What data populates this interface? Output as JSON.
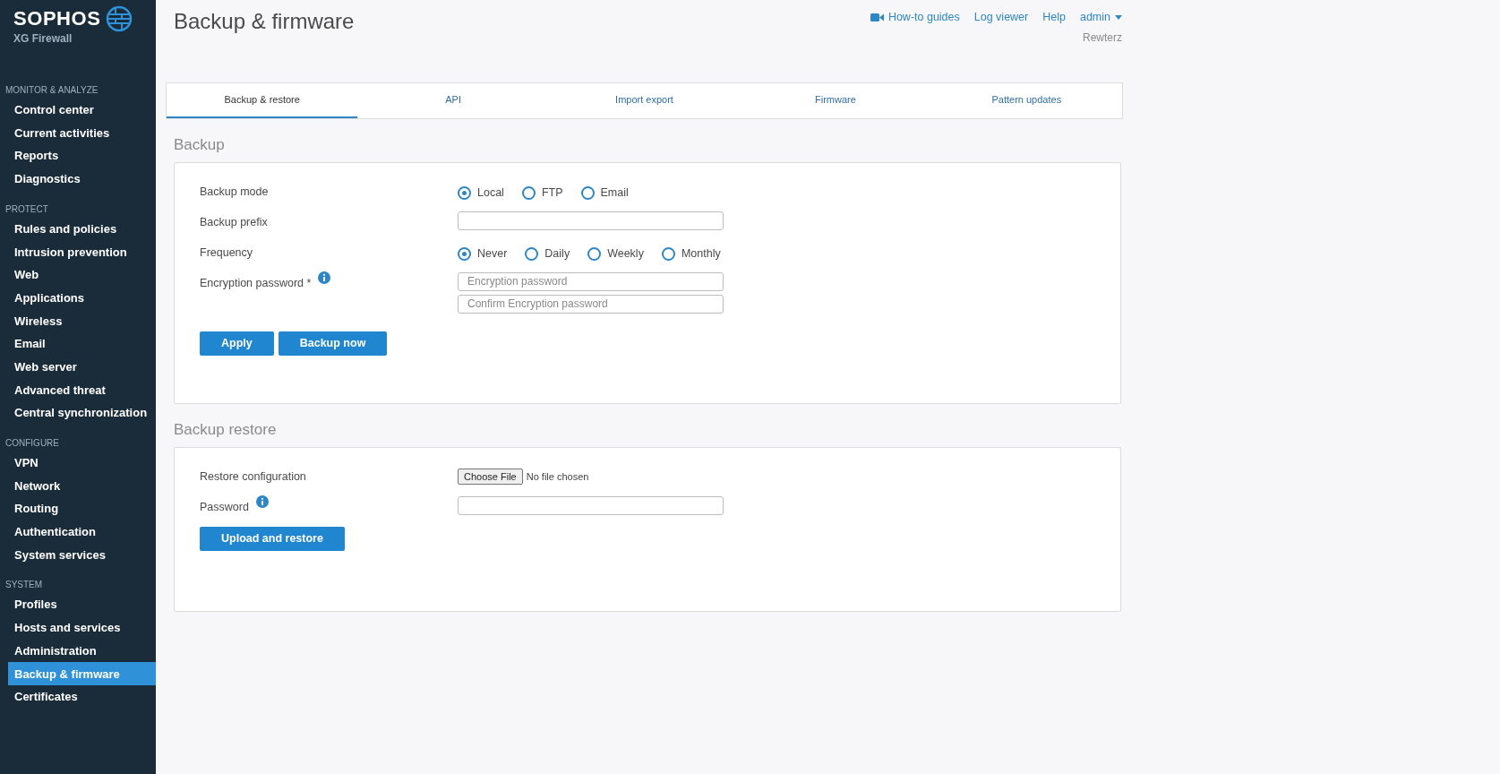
{
  "logo": {
    "brand": "SOPHOS",
    "product": "XG Firewall"
  },
  "sidebar": {
    "sections": [
      {
        "heading": "MONITOR & ANALYZE",
        "items": [
          {
            "label": "Control center",
            "selected": false
          },
          {
            "label": "Current activities",
            "selected": false
          },
          {
            "label": "Reports",
            "selected": false
          },
          {
            "label": "Diagnostics",
            "selected": false
          }
        ]
      },
      {
        "heading": "PROTECT",
        "items": [
          {
            "label": "Rules and policies",
            "selected": false
          },
          {
            "label": "Intrusion prevention",
            "selected": false
          },
          {
            "label": "Web",
            "selected": false
          },
          {
            "label": "Applications",
            "selected": false
          },
          {
            "label": "Wireless",
            "selected": false
          },
          {
            "label": "Email",
            "selected": false
          },
          {
            "label": "Web server",
            "selected": false
          },
          {
            "label": "Advanced threat",
            "selected": false
          },
          {
            "label": "Central synchronization",
            "selected": false
          }
        ]
      },
      {
        "heading": "CONFIGURE",
        "items": [
          {
            "label": "VPN",
            "selected": false
          },
          {
            "label": "Network",
            "selected": false
          },
          {
            "label": "Routing",
            "selected": false
          },
          {
            "label": "Authentication",
            "selected": false
          },
          {
            "label": "System services",
            "selected": false
          }
        ]
      },
      {
        "heading": "SYSTEM",
        "items": [
          {
            "label": "Profiles",
            "selected": false
          },
          {
            "label": "Hosts and services",
            "selected": false
          },
          {
            "label": "Administration",
            "selected": false
          },
          {
            "label": "Backup & firmware",
            "selected": true
          },
          {
            "label": "Certificates",
            "selected": false
          }
        ]
      }
    ]
  },
  "page_title": "Backup & firmware",
  "header_links": [
    {
      "label": "How-to guides",
      "kind": "video"
    },
    {
      "label": "Log viewer",
      "kind": "plain"
    },
    {
      "label": "Help",
      "kind": "plain"
    },
    {
      "label": "admin",
      "kind": "dropdown"
    }
  ],
  "device_name": "Rewterz",
  "tabs": [
    {
      "label": "Backup & restore",
      "selected": true
    },
    {
      "label": "API",
      "selected": false
    },
    {
      "label": "Import export",
      "selected": false
    },
    {
      "label": "Firmware",
      "selected": false
    },
    {
      "label": "Pattern updates",
      "selected": false
    }
  ],
  "backup": {
    "heading": "Backup",
    "rows": [
      {
        "kind": "radio",
        "label": "Backup mode",
        "options": [
          {
            "label": "Local",
            "selected": true
          },
          {
            "label": "FTP",
            "selected": false
          },
          {
            "label": "Email",
            "selected": false
          }
        ]
      },
      {
        "kind": "text",
        "label": "Backup prefix"
      },
      {
        "kind": "radio",
        "label": "Frequency",
        "options": [
          {
            "label": "Never",
            "selected": true
          },
          {
            "label": "Daily",
            "selected": false
          },
          {
            "label": "Weekly",
            "selected": false
          },
          {
            "label": "Monthly",
            "selected": false
          }
        ]
      },
      {
        "kind": "text",
        "label": "Encryption password *",
        "info": true,
        "fields": [
          {
            "placeholder": "Encryption password"
          },
          {
            "placeholder": "Confirm Encryption password"
          }
        ]
      }
    ],
    "buttons": [
      "Apply",
      "Backup now"
    ]
  },
  "restore": {
    "heading": "Backup restore",
    "rows": [
      {
        "kind": "file",
        "label": "Restore configuration",
        "button": "Choose File",
        "status": "No file chosen"
      },
      {
        "kind": "text",
        "label": "Password",
        "info": true
      }
    ],
    "buttons": [
      "Upload and restore"
    ]
  }
}
